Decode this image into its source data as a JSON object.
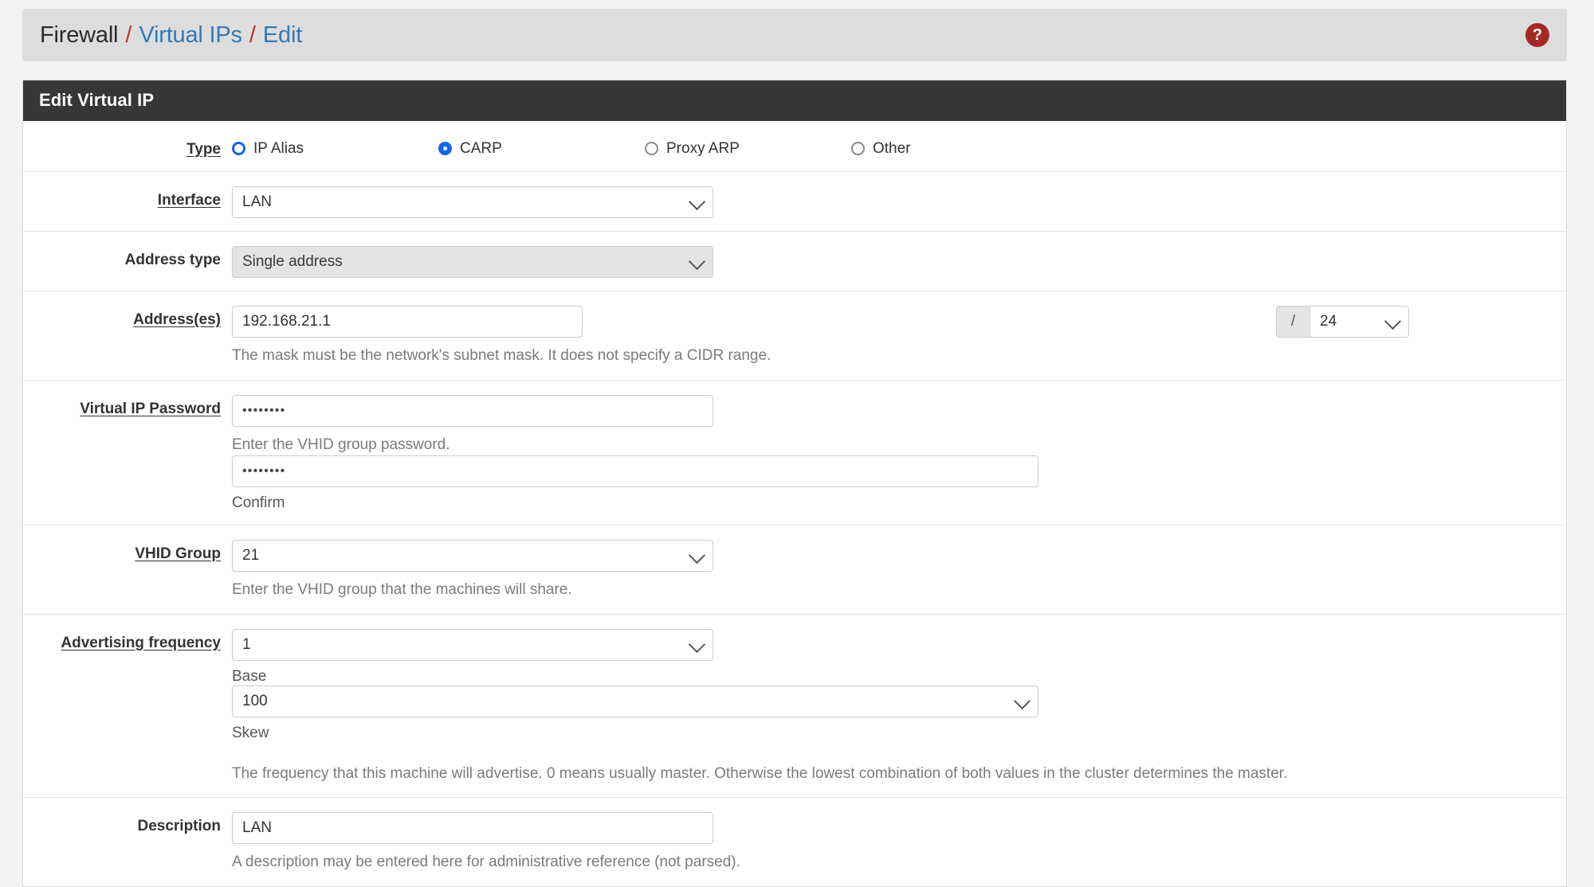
{
  "breadcrumb": {
    "items": [
      {
        "label": "Firewall",
        "link": false
      },
      {
        "label": "Virtual IPs",
        "link": true
      },
      {
        "label": "Edit",
        "link": true
      }
    ],
    "separator": "/",
    "help_icon": "?"
  },
  "panel": {
    "title": "Edit Virtual IP"
  },
  "form": {
    "type": {
      "label": "Type",
      "options": [
        {
          "label": "IP Alias",
          "checked": false,
          "focused": true
        },
        {
          "label": "CARP",
          "checked": true,
          "focused": false
        },
        {
          "label": "Proxy ARP",
          "checked": false,
          "focused": false
        },
        {
          "label": "Other",
          "checked": false,
          "focused": false
        }
      ]
    },
    "interface": {
      "label": "Interface",
      "value": "LAN"
    },
    "address_type": {
      "label": "Address type",
      "value": "Single address",
      "disabled": true
    },
    "addresses": {
      "label": "Address(es)",
      "value": "192.168.21.1",
      "cidr_prefix": "/",
      "cidr_value": "24",
      "help": "The mask must be the network's subnet mask. It does not specify a CIDR range."
    },
    "vip_password": {
      "label": "Virtual IP Password",
      "value": "••••••••",
      "help": "Enter the VHID group password.",
      "confirm_value": "••••••••",
      "confirm_label": "Confirm"
    },
    "vhid_group": {
      "label": "VHID Group",
      "value": "21",
      "help": "Enter the VHID group that the machines will share."
    },
    "advertising_frequency": {
      "label": "Advertising frequency",
      "base_value": "1",
      "base_label": "Base",
      "skew_value": "100",
      "skew_label": "Skew",
      "help": "The frequency that this machine will advertise. 0 means usually master. Otherwise the lowest combination of both values in the cluster determines the master."
    },
    "description": {
      "label": "Description",
      "value": "LAN",
      "help": "A description may be entered here for administrative reference (not parsed)."
    }
  }
}
